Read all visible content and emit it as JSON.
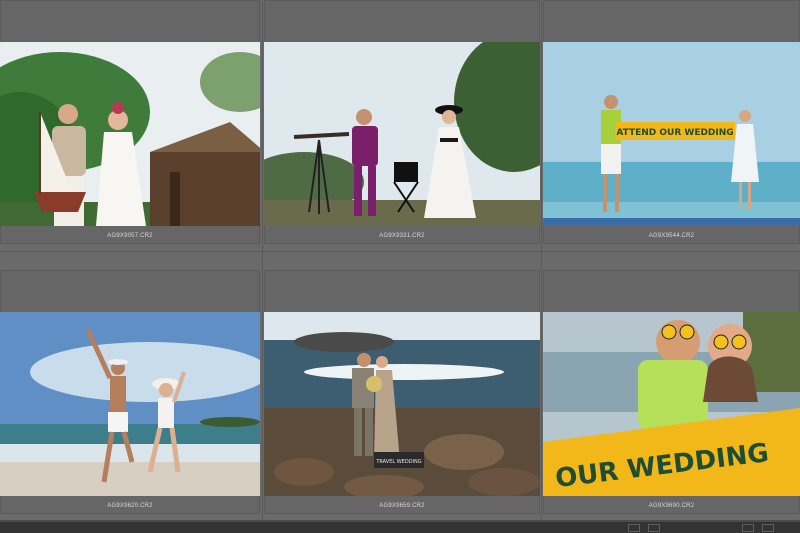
{
  "app": {
    "view": "Grid Library"
  },
  "photos": [
    {
      "filename": "AG9X9057.CR2",
      "scene": "couple-with-sailboat"
    },
    {
      "filename": "AG9X9331.CR2",
      "scene": "couple-with-telescope"
    },
    {
      "filename": "AG9X9544.CR2",
      "scene": "couple-with-banner"
    },
    {
      "filename": "AG9X9620.CR2",
      "scene": "couple-jumping-beach"
    },
    {
      "filename": "AG9X9659.CR2",
      "scene": "couple-kissing-rocks"
    },
    {
      "filename": "AG9X9690.CR2",
      "scene": "couple-closeup-banner"
    }
  ],
  "banner_texts": {
    "top": "ATTEND OUR WEDDING",
    "closeup": "OUR WEDDING"
  },
  "sign_text": "TRAVEL WEDDING",
  "colors": {
    "background": "#6b6b6b",
    "cell": "#666666",
    "caption": "#d8d8d8",
    "banner_yellow": "#f2b81a"
  }
}
